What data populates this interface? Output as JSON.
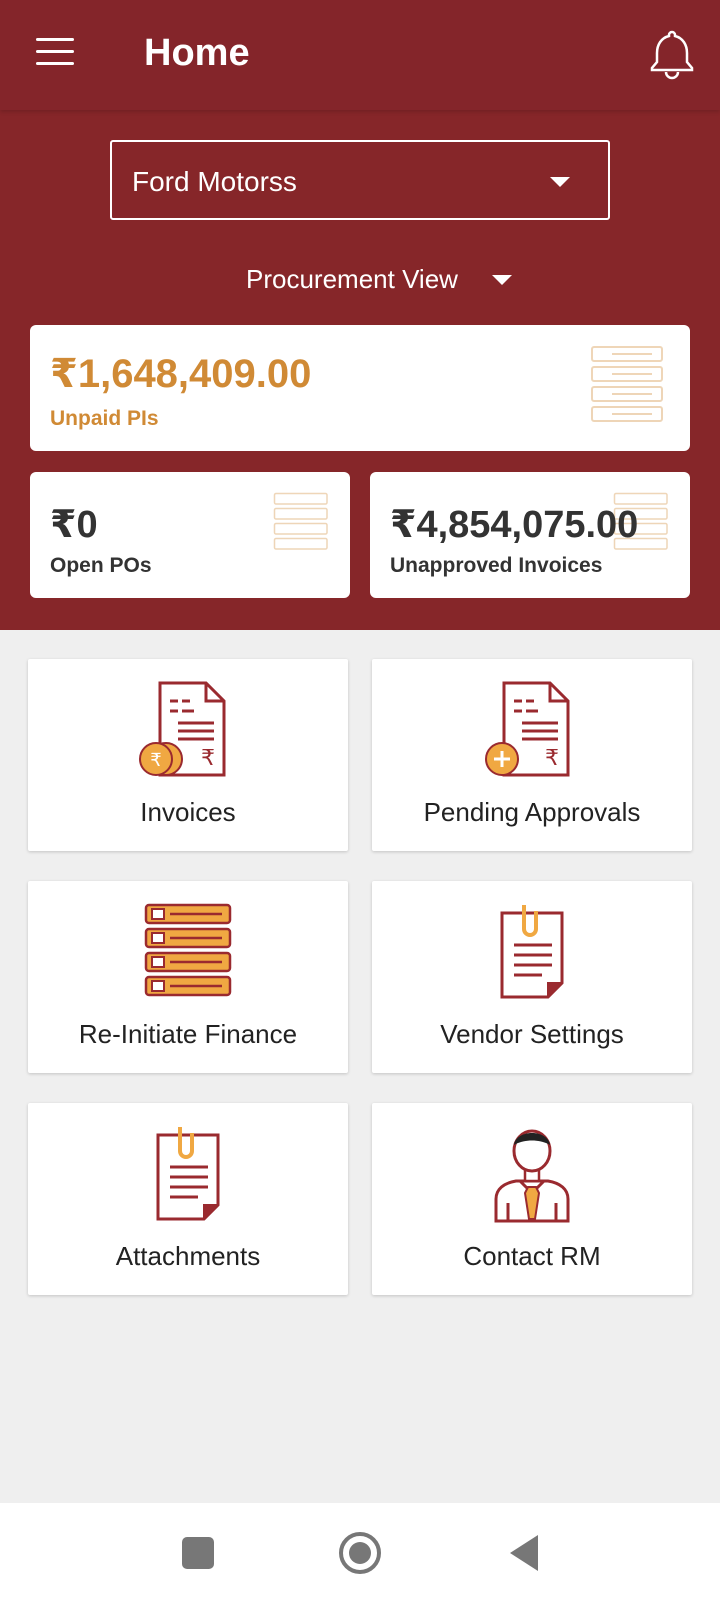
{
  "appbar": {
    "title": "Home"
  },
  "company_select": {
    "value": "Ford Motorss"
  },
  "view_select": {
    "value": "Procurement View"
  },
  "stats": {
    "unpaid": {
      "amount": "₹1,648,409.00",
      "label": "Unpaid PIs"
    },
    "open_pos": {
      "amount": "₹0",
      "label": "Open POs"
    },
    "unapproved": {
      "amount": "₹4,854,075.00",
      "label": "Unapproved Invoices"
    }
  },
  "tiles": [
    {
      "label": "Invoices",
      "icon": "invoice-rupee-icon"
    },
    {
      "label": "Pending Approvals",
      "icon": "invoice-add-icon"
    },
    {
      "label": "Re-Initiate Finance",
      "icon": "checklist-stack-icon"
    },
    {
      "label": "Vendor Settings",
      "icon": "clipped-document-icon"
    },
    {
      "label": "Attachments",
      "icon": "clipped-document-icon"
    },
    {
      "label": "Contact RM",
      "icon": "relationship-manager-icon"
    }
  ],
  "colors": {
    "primary": "#862629",
    "accent": "#d08a35",
    "orange": "#f0a842",
    "icon_stroke": "#9a2a2f"
  }
}
